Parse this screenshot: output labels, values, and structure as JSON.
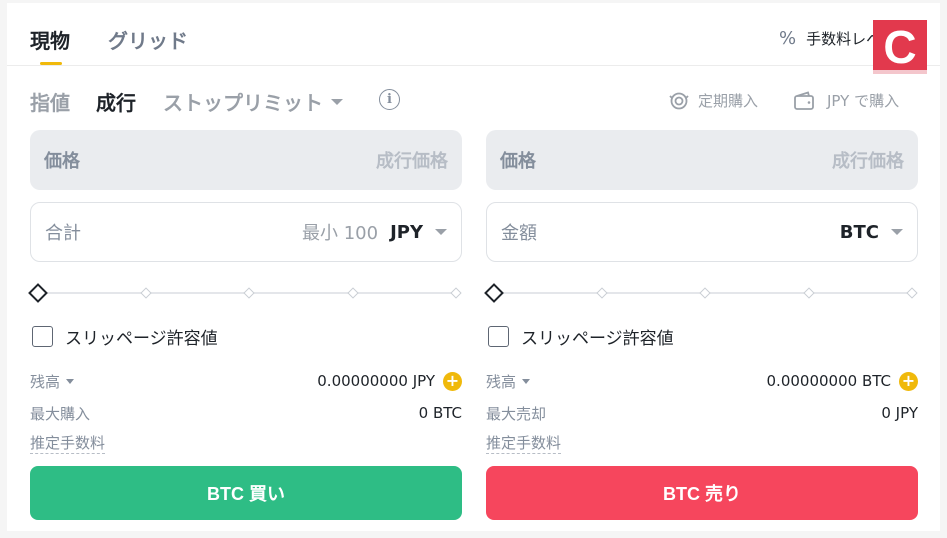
{
  "tabs": [
    {
      "label": "現物",
      "active": true
    },
    {
      "label": "グリッド",
      "active": false
    }
  ],
  "fee_level": {
    "icon": "percent-icon",
    "label": "手数料レベル"
  },
  "logo": {
    "text": "C",
    "color": "#e2394d"
  },
  "order_types": {
    "limit": "指値",
    "market": "成行",
    "stop_limit": "ストップリミット",
    "selected": "market"
  },
  "links": {
    "recurring": "定期購入",
    "buy_with_jpy": "JPY で購入"
  },
  "buy": {
    "price_label": "価格",
    "price_value": "成行価格",
    "amount_label": "合計",
    "amount_placeholder": "最小 100",
    "amount_unit": "JPY",
    "slider_fraction": 0,
    "slippage_label": "スリッページ許容値",
    "slippage_checked": false,
    "balance_label": "残高",
    "balance_value": "0.00000000 JPY",
    "max_label": "最大購入",
    "max_value": "0 BTC",
    "fee_label": "推定手数料",
    "button_label": "BTC 買い",
    "button_color": "#2ebd85"
  },
  "sell": {
    "price_label": "価格",
    "price_value": "成行価格",
    "amount_label": "金額",
    "amount_unit": "BTC",
    "slider_fraction": 0,
    "slippage_label": "スリッページ許容値",
    "slippage_checked": false,
    "balance_label": "残高",
    "balance_value": "0.00000000 BTC",
    "max_label": "最大売却",
    "max_value": "0 JPY",
    "fee_label": "推定手数料",
    "button_label": "BTC 売り",
    "button_color": "#f6465d"
  },
  "colors": {
    "accent": "#f0b90b",
    "buy": "#2ebd85",
    "sell": "#f6465d"
  }
}
